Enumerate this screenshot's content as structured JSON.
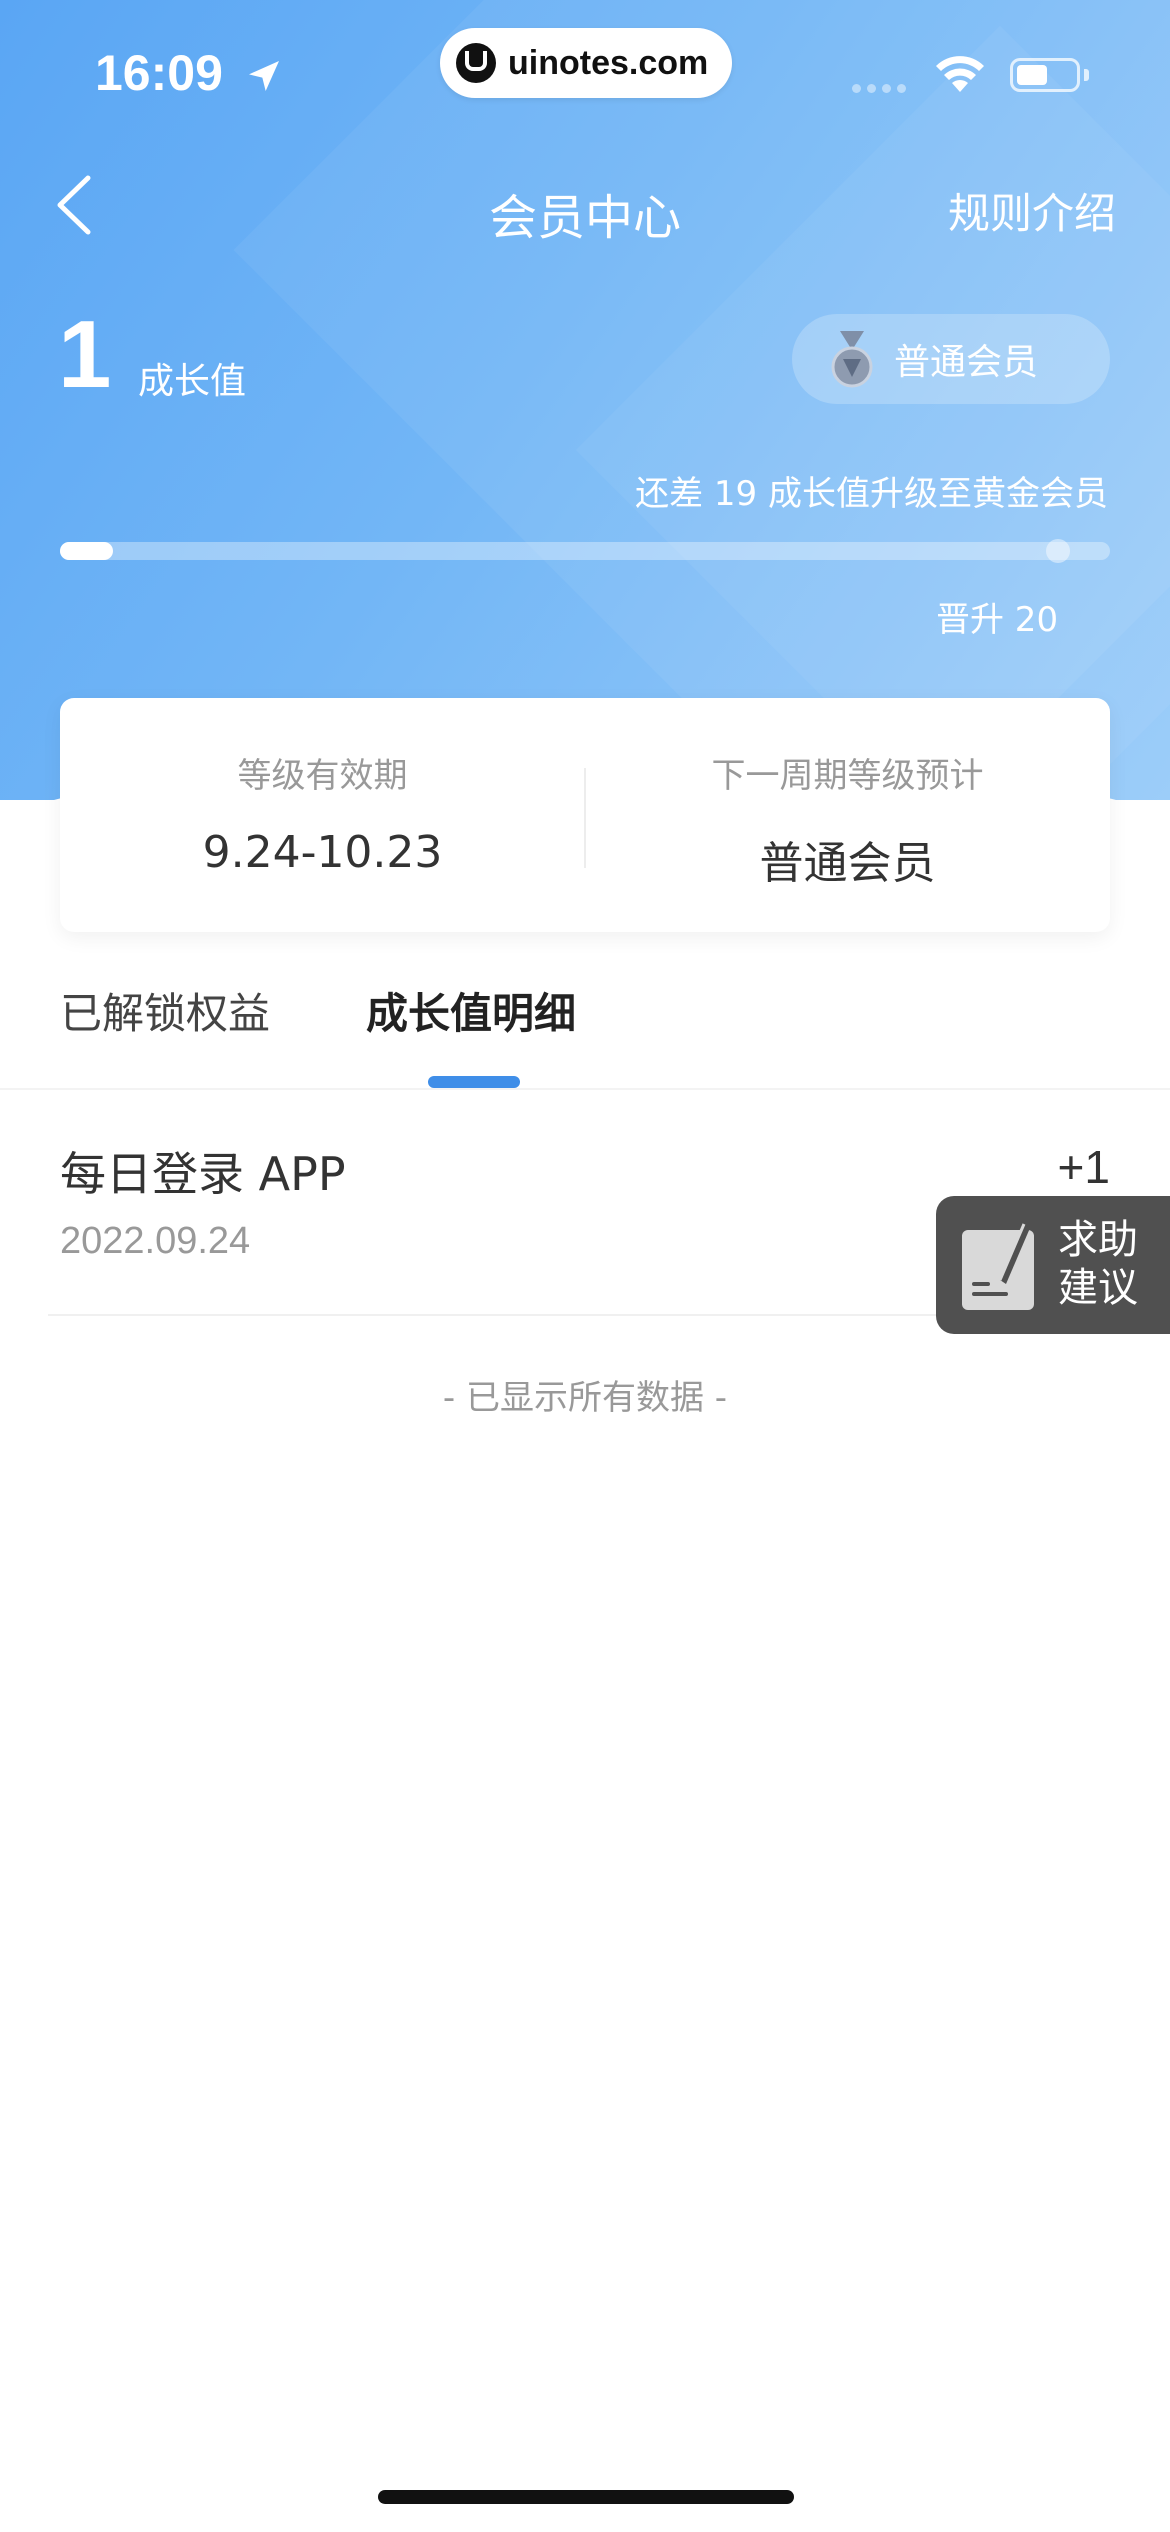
{
  "status_bar": {
    "time": "16:09",
    "url": "uinotes.com"
  },
  "nav": {
    "title": "会员中心",
    "rules_label": "规则介绍"
  },
  "growth": {
    "value": "1",
    "label": "成长值",
    "member_level": "普通会员",
    "upgrade_hint": "还差 19 成长值升级至黄金会员",
    "progress": 0.05,
    "milestone": "晋升 20"
  },
  "level_card": {
    "validity_label": "等级有效期",
    "validity_value": "9.24-10.23",
    "next_label": "下一周期等级预计",
    "next_value": "普通会员"
  },
  "tabs": [
    {
      "label": "已解锁权益",
      "active": false
    },
    {
      "label": "成长值明细",
      "active": true
    }
  ],
  "records": [
    {
      "title": "每日登录 APP",
      "date": "2022.09.24",
      "points": "+1"
    }
  ],
  "footer_hint": "- 已显示所有数据 -",
  "help": {
    "line1": "求助",
    "line2": "建议"
  },
  "colors": {
    "accent": "#3f8ee8",
    "header_start": "#5aa6f4",
    "header_end": "#9ccdf9"
  }
}
